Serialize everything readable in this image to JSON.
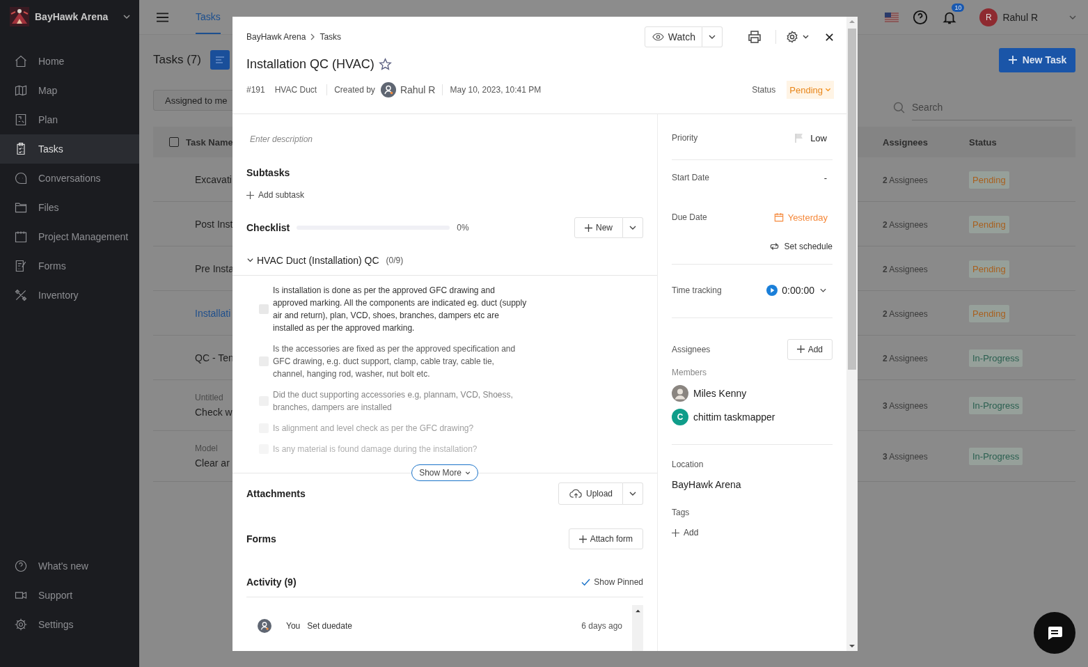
{
  "sidebar": {
    "workspace": "BayHawk Arena",
    "items": [
      {
        "label": "Home",
        "selected": false
      },
      {
        "label": "Map",
        "selected": false
      },
      {
        "label": "Plan",
        "selected": false
      },
      {
        "label": "Tasks",
        "selected": true
      },
      {
        "label": "Conversations",
        "selected": false
      },
      {
        "label": "Files",
        "selected": false
      },
      {
        "label": "Project Management",
        "selected": false
      },
      {
        "label": "Forms",
        "selected": false
      },
      {
        "label": "Inventory",
        "selected": false
      }
    ],
    "footer_items": [
      {
        "label": "What's new",
        "selected": false
      },
      {
        "label": "Support",
        "selected": false
      },
      {
        "label": "Settings",
        "selected": false
      }
    ]
  },
  "topbar": {
    "tabs": [
      {
        "label": "Tasks",
        "selected": true
      }
    ],
    "notifications": "10",
    "user": {
      "initial": "R",
      "name": "Rahul R"
    }
  },
  "page": {
    "title": "Tasks (7)",
    "new_task": "New Task",
    "filter": "Assigned to me",
    "search": {
      "placeholder": "Search"
    }
  },
  "table": {
    "all_checked": false,
    "columns": [
      "Task Name",
      "Assignees",
      "Status"
    ],
    "rows": [
      {
        "name": "Excavati",
        "assignees": "**2** Assignees",
        "status": "Pending",
        "color": "#a8601f",
        "selected": false
      },
      {
        "name": "Post Inst",
        "assignees": "**2** Assignees",
        "status": "Pending",
        "color": "#a8601f",
        "selected": false
      },
      {
        "name": "Pre Insta",
        "assignees": "**2** Assignees",
        "status": "Pending",
        "color": "#a8601f",
        "selected": false
      },
      {
        "name": "Installati",
        "assignees": "**2** Assignees",
        "status": "Pending",
        "color": "#a8601f",
        "selected": true
      },
      {
        "name": "QC - Ten",
        "assignees": "**2** Assignees",
        "status": "In-Progress",
        "color": "#2a5f50",
        "selected": false
      },
      {
        "group": "Untitled",
        "name": "Check w",
        "assignees": "**3** Assignees",
        "status": "In-Progress",
        "color": "#2a5f50",
        "selected": false
      },
      {
        "group": "Model",
        "name": "Clear ar",
        "assignees": "**3** Assignees",
        "status": "In-Progress",
        "color": "#2a5f50",
        "selected": false
      }
    ]
  },
  "task_panel": {
    "breadcrumb": [
      "BayHawk Arena",
      "Tasks"
    ],
    "watch": "Watch",
    "title": "Installation QC (HVAC)",
    "starred": false,
    "id": "#191",
    "category": "HVAC Duct",
    "created_by_label": "Created by",
    "creator": "Rahul R",
    "created_at": "May 10, 2023, 10:41 PM",
    "status_label": "Status",
    "status": "Pending",
    "description": {
      "placeholder": "Enter description"
    },
    "subtasks": {
      "label": "Subtasks",
      "add": "Add subtask"
    },
    "checklist": {
      "label": "Checklist",
      "level": 0,
      "percent": "0%",
      "new_button": "New",
      "group": {
        "title": "HVAC Duct (Installation) QC",
        "count": "(0/9)",
        "expanded": true,
        "items": [
          {
            "text": "Is installation is done as per the approved GFC drawing and approved marking. All the components are indicated eg. duct (supply air and return), plan, VCD, shoes, branches, dampers etc are installed as per the approved marking.",
            "checked": false
          },
          {
            "text": "Is the accessories are fixed as per the approved specification and GFC drawing, e.g. duct support, clamp, cable tray, cable tie, channel, hanging rod, washer, nut bolt etc.",
            "checked": false
          },
          {
            "text": "Did the duct supporting accessories e.g, plannam, VCD, Shoess, branches, dampers are installed",
            "checked": false
          },
          {
            "text": "Is alignment and level check as per the GFC drawing?",
            "checked": false
          },
          {
            "text": "Is any material is found damage during the installation?",
            "checked": false
          }
        ]
      },
      "show_more": "Show More"
    },
    "attachments": {
      "label": "Attachments",
      "button": "Upload"
    },
    "forms": {
      "label": "Forms",
      "button": "Attach form"
    },
    "activity": {
      "label": "Activity (9)",
      "show_pinned": "Show Pinned",
      "items": [
        {
          "actor": "You",
          "action": "Set duedate",
          "time": "6 days ago"
        }
      ]
    },
    "details": {
      "priority": {
        "label": "Priority",
        "value": "Low"
      },
      "start_date": {
        "label": "Start Date",
        "value": "-"
      },
      "due_date": {
        "label": "Due Date",
        "value": "Yesterday",
        "overdue": true
      },
      "set_schedule": "Set schedule",
      "time_tracking": {
        "label": "Time tracking",
        "value": "0:00:00"
      },
      "assignees": {
        "label": "Assignees",
        "add": "Add",
        "group_label": "Members",
        "members": [
          {
            "name": "Miles Kenny",
            "kind": "photo"
          },
          {
            "name": "chittim taskmapper",
            "kind": "initial",
            "initial": "C",
            "color": "#0f9d8a"
          }
        ]
      },
      "location": {
        "label": "Location",
        "value": "BayHawk Arena"
      },
      "tags": {
        "label": "Tags",
        "add": "Add"
      }
    }
  }
}
